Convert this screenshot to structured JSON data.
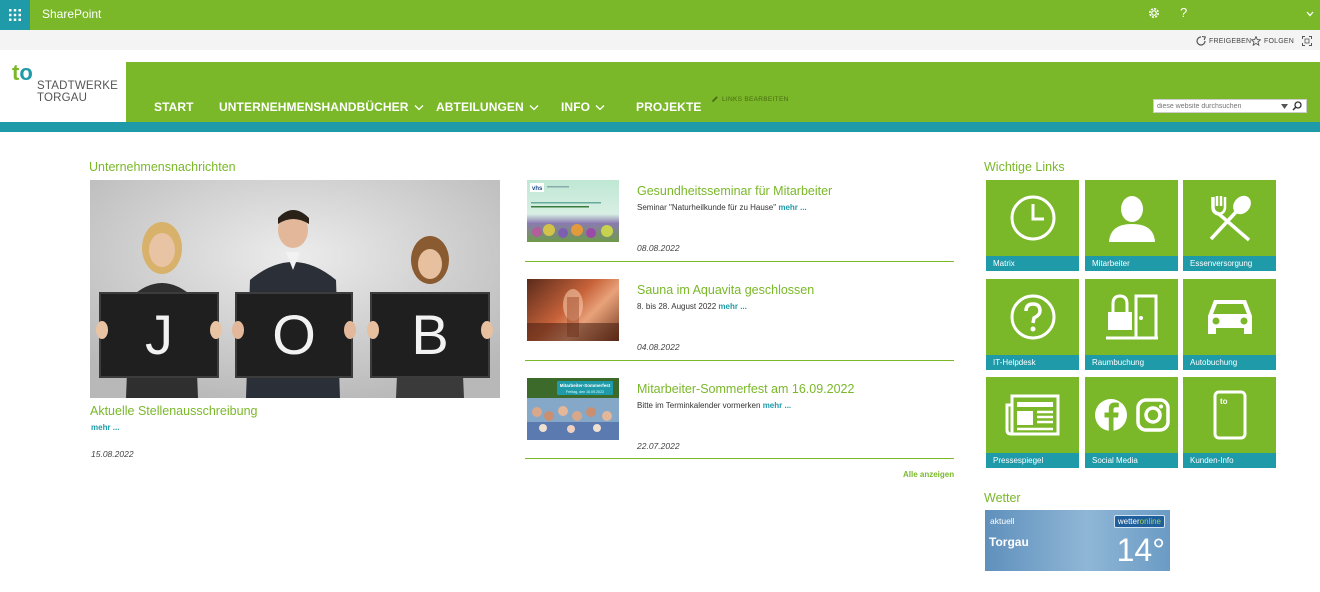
{
  "suite": {
    "app_name": "SharePoint",
    "help": "?"
  },
  "actions": {
    "share": "FREIGEBEN",
    "follow": "FOLGEN"
  },
  "logo": {
    "mark_t": "t",
    "mark_o": "o",
    "line1": "STADTWERKE",
    "line2": "TORGAU"
  },
  "nav": {
    "items": [
      {
        "label": "START",
        "dropdown": false
      },
      {
        "label": "UNTERNEHMENSHANDBÜCHER",
        "dropdown": true
      },
      {
        "label": "ABTEILUNGEN",
        "dropdown": true
      },
      {
        "label": "INFO",
        "dropdown": true
      },
      {
        "label": "PROJEKTE",
        "dropdown": false
      }
    ],
    "edit_links": "LINKS BEARBEITEN"
  },
  "search": {
    "placeholder": "diese website durchsuchen"
  },
  "news": {
    "title": "Unternehmensnachrichten",
    "featured": {
      "letters": [
        "J",
        "O",
        "B"
      ],
      "caption": "Aktuelle Stellenausschreibung",
      "more": "mehr ...",
      "date": "15.08.2022"
    },
    "items": [
      {
        "title": "Gesundheitsseminar für Mitarbeiter",
        "desc": "Seminar \"Naturheilkunde für zu Hause\"",
        "more": "mehr ...",
        "date": "08.08.2022",
        "thumb_text": "vhs"
      },
      {
        "title": "Sauna im Aquavita geschlossen",
        "desc": "8. bis 28. August 2022",
        "more": "mehr ...",
        "date": "04.08.2022",
        "thumb_text": ""
      },
      {
        "title": "Mitarbeiter-Sommerfest am 16.09.2022",
        "desc": "Bitte im Terminkalender vormerken",
        "more": "mehr ...",
        "date": "22.07.2022",
        "thumb_text": "Mitarbeiter-Sommerfest",
        "thumb_subtext": "Freitag, den 16.09.2022"
      }
    ],
    "show_all": "Alle anzeigen"
  },
  "links": {
    "title": "Wichtige Links",
    "tiles": [
      {
        "label": "Matrix",
        "icon": "clock-icon"
      },
      {
        "label": "Mitarbeiter",
        "icon": "person-icon"
      },
      {
        "label": "Essenversorgung",
        "icon": "fork-spoon-icon"
      },
      {
        "label": "IT-Helpdesk",
        "icon": "question-icon"
      },
      {
        "label": "Raumbuchung",
        "icon": "lock-door-icon"
      },
      {
        "label": "Autobuchung",
        "icon": "car-icon"
      },
      {
        "label": "Pressespiegel",
        "icon": "newspaper-icon"
      },
      {
        "label": "Social Media",
        "icon": "facebook-instagram-icon"
      },
      {
        "label": "Kunden-Info",
        "icon": "card-icon"
      }
    ]
  },
  "weather": {
    "title": "Wetter",
    "now_label": "aktuell",
    "city": "Torgau",
    "temp": "14°",
    "brand_a": "wetter",
    "brand_b": "online"
  },
  "colors": {
    "green": "#7ab829",
    "teal": "#1f9aa8"
  }
}
